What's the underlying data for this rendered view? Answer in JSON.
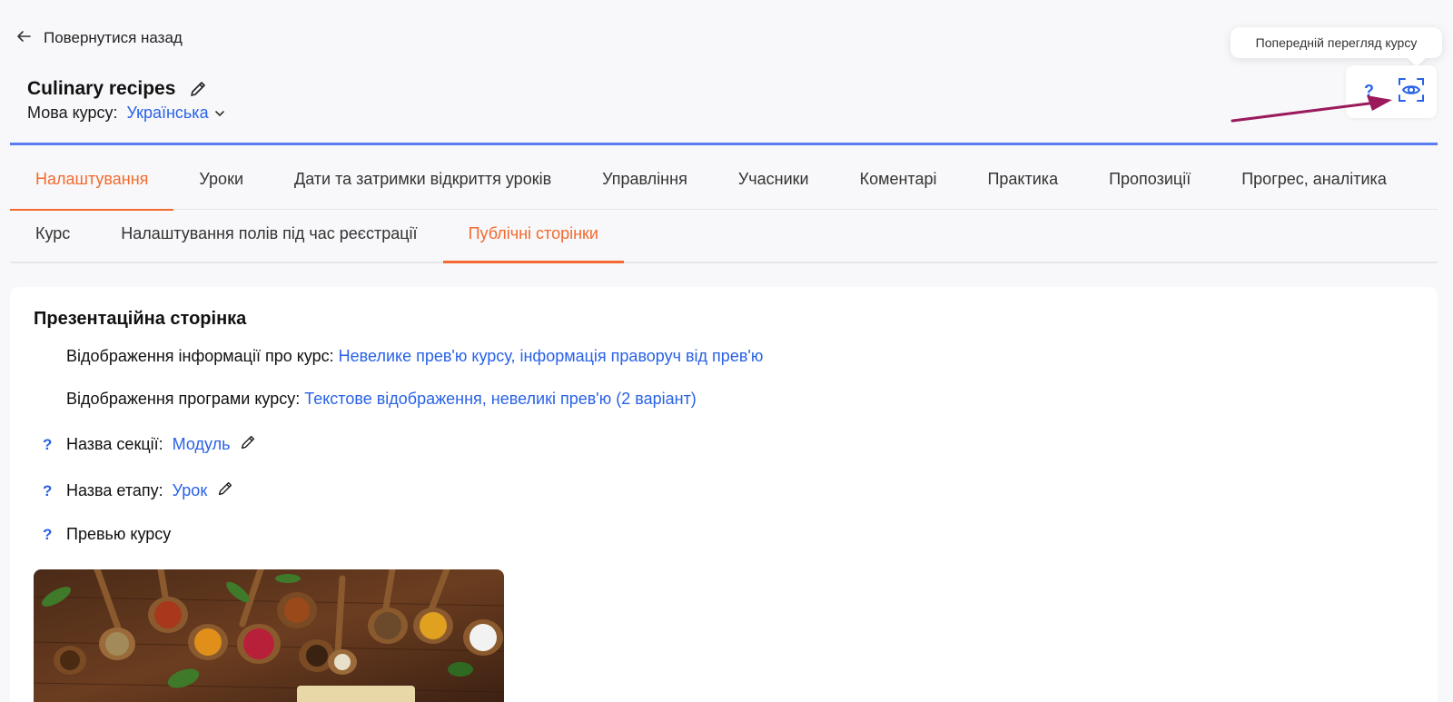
{
  "header": {
    "back_label": "Повернутися назад",
    "course_title": "Culinary recipes",
    "language_label": "Мова курсу:",
    "language_value": "Українська",
    "help_label": "?",
    "preview_tooltip": "Попередній перегляд курсу"
  },
  "main_tabs": [
    {
      "label": "Налаштування",
      "active": true
    },
    {
      "label": "Уроки"
    },
    {
      "label": "Дати та затримки відкриття уроків"
    },
    {
      "label": "Управління"
    },
    {
      "label": "Учасники"
    },
    {
      "label": "Коментарі"
    },
    {
      "label": "Практика"
    },
    {
      "label": "Пропозиції"
    },
    {
      "label": "Прогрес, аналітика"
    }
  ],
  "sub_tabs": [
    {
      "label": "Курс"
    },
    {
      "label": "Налаштування полів під час реєстрації"
    },
    {
      "label": "Публічні сторінки",
      "active": true
    }
  ],
  "content": {
    "section_title": "Презентаційна сторінка",
    "info_display_label": "Відображення інформації про курс:",
    "info_display_value": "Невелике прев'ю курсу, інформація праворуч від прев'ю",
    "program_display_label": "Відображення програми курсу:",
    "program_display_value": "Текстове відображення, невеликі прев'ю (2 варіант)",
    "section_name_label": "Назва секції:",
    "section_name_value": "Модуль",
    "stage_name_label": "Назва етапу:",
    "stage_name_value": "Урок",
    "preview_label": "Превью курсу",
    "help_mark": "?"
  },
  "colors": {
    "accent_orange": "#f26a2e",
    "link_blue": "#2962e6",
    "annotation_arrow": "#9a1a5c"
  }
}
